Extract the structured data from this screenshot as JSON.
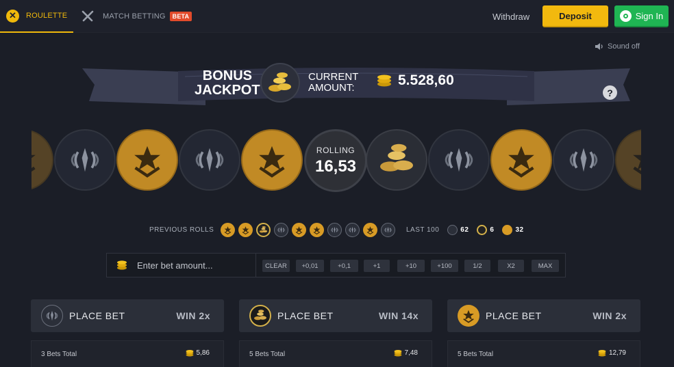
{
  "nav": {
    "roulette_label": "ROULETTE",
    "match_label": "MATCH BETTING",
    "beta_label": "BETA",
    "withdraw_label": "Withdraw",
    "deposit_label": "Deposit",
    "signin_label": "Sign In"
  },
  "sound": {
    "label": "Sound off"
  },
  "jackpot": {
    "title_line1": "BONUS",
    "title_line2": "JACKPOT",
    "current_line1": "CURRENT",
    "current_line2": "AMOUNT:",
    "amount": "5.528,60"
  },
  "roll": {
    "label": "ROLLING",
    "value": "16,53"
  },
  "roller_sequence": [
    "t",
    "ct",
    "t",
    "ct",
    "t",
    "roll",
    "bonus",
    "ct",
    "t",
    "ct",
    "t"
  ],
  "previous_rolls": {
    "label": "PREVIOUS ROLLS",
    "items": [
      "t",
      "t",
      "bonus",
      "ct",
      "t",
      "t",
      "ct",
      "ct",
      "t",
      "ct"
    ]
  },
  "last100": {
    "label": "LAST 100",
    "ct_count": "62",
    "bonus_count": "6",
    "t_count": "32"
  },
  "bet": {
    "placeholder": "Enter bet amount...",
    "buttons": [
      "CLEAR",
      "+0,01",
      "+0,1",
      "+1",
      "+10",
      "+100",
      "1/2",
      "X2",
      "MAX"
    ]
  },
  "panels": [
    {
      "type": "ct",
      "label": "PLACE BET",
      "win": "WIN 2x",
      "bets": "3 Bets Total",
      "total": "5,86"
    },
    {
      "type": "bonus",
      "label": "PLACE BET",
      "win": "WIN 14x",
      "bets": "5 Bets Total",
      "total": "7,48"
    },
    {
      "type": "t",
      "label": "PLACE BET",
      "win": "WIN 2x",
      "bets": "5 Bets Total",
      "total": "12,79"
    }
  ],
  "colors": {
    "accent": "#f2b90e",
    "signin": "#1fb553",
    "t_gold": "#c18a25",
    "beta": "#e24b2b"
  }
}
